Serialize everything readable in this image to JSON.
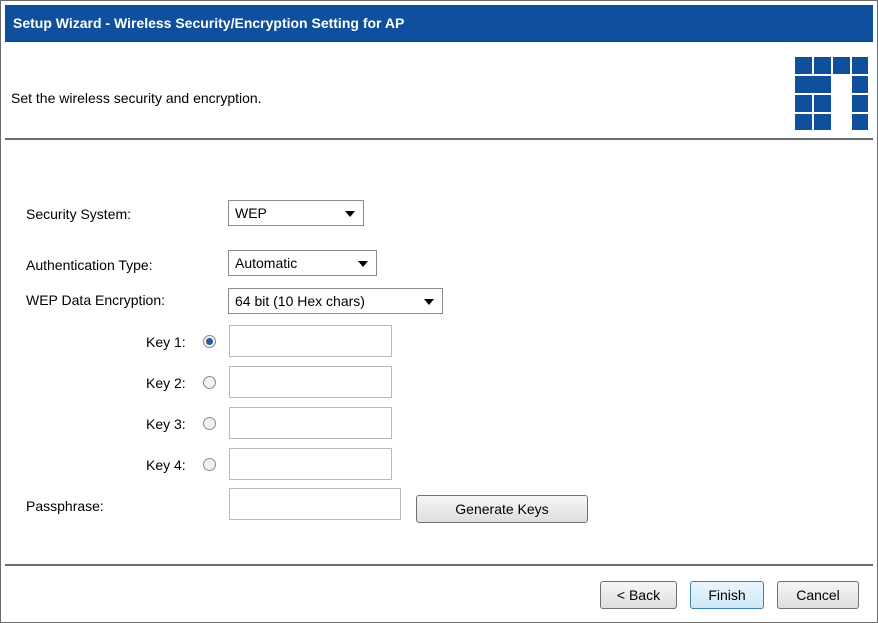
{
  "title": "Setup Wizard - Wireless Security/Encryption Setting for AP",
  "subtitle": "Set the wireless security and encryption.",
  "form": {
    "security_system_label": "Security System:",
    "security_system_value": "WEP",
    "auth_type_label": "Authentication Type:",
    "auth_type_value": "Automatic",
    "wep_encryption_label": "WEP Data Encryption:",
    "wep_encryption_value": "64 bit (10 Hex chars)",
    "keys": [
      {
        "label": "Key 1:",
        "selected": true,
        "value": ""
      },
      {
        "label": "Key 2:",
        "selected": false,
        "value": ""
      },
      {
        "label": "Key 3:",
        "selected": false,
        "value": ""
      },
      {
        "label": "Key 4:",
        "selected": false,
        "value": ""
      }
    ],
    "passphrase_label": "Passphrase:",
    "passphrase_value": "",
    "generate_keys_label": "Generate Keys"
  },
  "buttons": {
    "back": "< Back",
    "finish": "Finish",
    "cancel": "Cancel"
  },
  "colors": {
    "titlebar": "#0f4f9c",
    "logo": "#0f4f9c"
  }
}
